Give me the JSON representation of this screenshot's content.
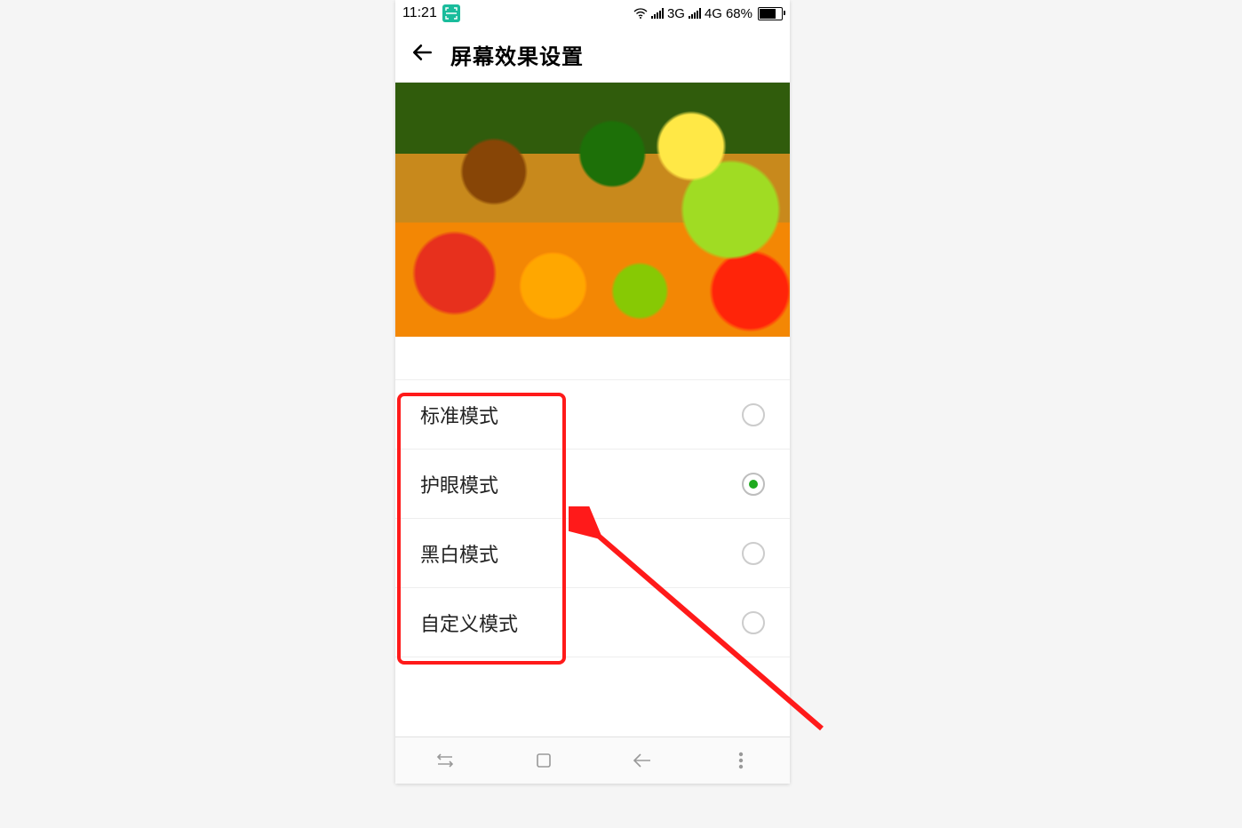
{
  "status": {
    "time": "11:21",
    "net1": "3G",
    "net2": "4G",
    "battery_pct": "68%"
  },
  "header": {
    "title": "屏幕效果设置"
  },
  "modes": {
    "items": [
      {
        "label": "标准模式",
        "selected": false
      },
      {
        "label": "护眼模式",
        "selected": true
      },
      {
        "label": "黑白模式",
        "selected": false
      },
      {
        "label": "自定义模式",
        "selected": false
      }
    ]
  }
}
